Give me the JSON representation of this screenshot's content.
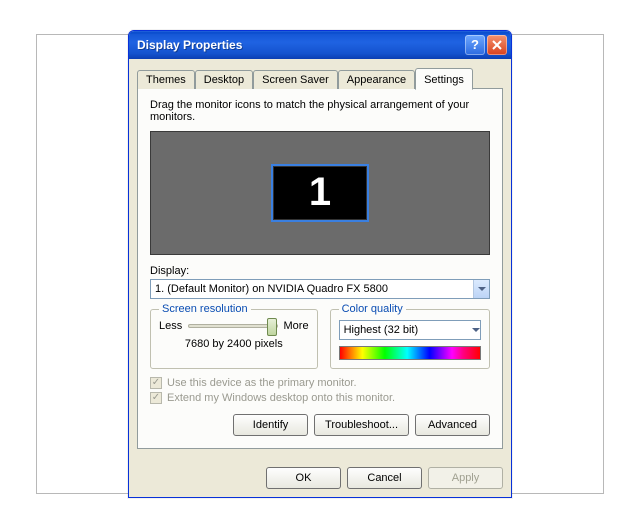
{
  "window": {
    "title": "Display Properties"
  },
  "tabs": {
    "items": [
      "Themes",
      "Desktop",
      "Screen Saver",
      "Appearance",
      "Settings"
    ],
    "active_index": 4
  },
  "settings": {
    "instruction": "Drag the monitor icons to match the physical arrangement of your monitors.",
    "monitor_number": "1",
    "display_label": "Display:",
    "display_value": "1. (Default Monitor) on NVIDIA Quadro FX 5800",
    "resolution": {
      "legend": "Screen resolution",
      "less": "Less",
      "more": "More",
      "value": "7680 by 2400 pixels"
    },
    "color_quality": {
      "legend": "Color quality",
      "value": "Highest (32 bit)"
    },
    "checks": {
      "primary": "Use this device as the primary monitor.",
      "extend": "Extend my Windows desktop onto this monitor."
    },
    "buttons": {
      "identify": "Identify",
      "troubleshoot": "Troubleshoot...",
      "advanced": "Advanced"
    }
  },
  "dialog_buttons": {
    "ok": "OK",
    "cancel": "Cancel",
    "apply": "Apply"
  }
}
